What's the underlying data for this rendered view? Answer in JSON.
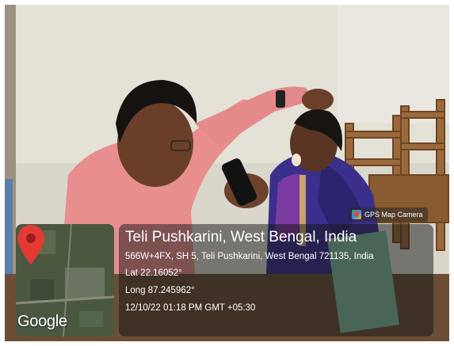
{
  "photo": {
    "subject": "photo"
  },
  "camera_badge": {
    "label": "GPS Map Camera",
    "icon": "gps-map-camera-icon"
  },
  "map": {
    "provider_label": "Google",
    "pin_icon": "location-pin-icon",
    "pin_color": "#e53935"
  },
  "location": {
    "title": "Teli Pushkarini, West Bengal, India",
    "address": "566W+4FX, SH 5, Teli Pushkarini, West Bengal 721135, India",
    "latitude": "Lat 22.16052°",
    "longitude": "Long 87.245962°",
    "timestamp": "12/10/22 01:18 PM GMT +05:30"
  }
}
